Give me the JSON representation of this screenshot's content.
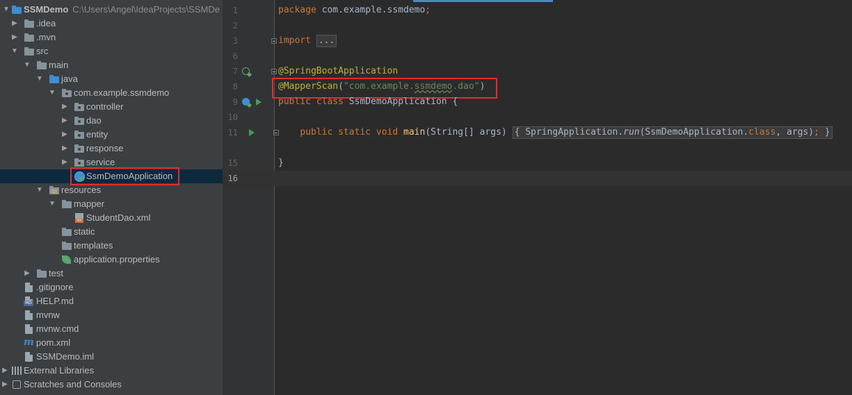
{
  "project": {
    "name": "SSMDemo",
    "path": "C:\\Users\\Angel\\IdeaProjects\\SSMDe",
    "items": [
      {
        "label": ".idea"
      },
      {
        "label": ".mvn"
      },
      {
        "label": "src"
      },
      {
        "label": "main"
      },
      {
        "label": "java"
      },
      {
        "label": "com.example.ssmdemo"
      },
      {
        "label": "controller"
      },
      {
        "label": "dao"
      },
      {
        "label": "entity"
      },
      {
        "label": "response"
      },
      {
        "label": "service"
      },
      {
        "label": "SsmDemoApplication"
      },
      {
        "label": "resources"
      },
      {
        "label": "mapper"
      },
      {
        "label": "StudentDao.xml"
      },
      {
        "label": "static"
      },
      {
        "label": "templates"
      },
      {
        "label": "application.properties"
      },
      {
        "label": "test"
      },
      {
        "label": ".gitignore"
      },
      {
        "label": "HELP.md"
      },
      {
        "label": "mvnw"
      },
      {
        "label": "mvnw.cmd"
      },
      {
        "label": "pom.xml"
      },
      {
        "label": "SSMDemo.iml"
      },
      {
        "label": "External Libraries"
      },
      {
        "label": "Scratches and Consoles"
      }
    ]
  },
  "editor": {
    "line_numbers": [
      "1",
      "2",
      "3",
      "6",
      "7",
      "8",
      "9",
      "10",
      "11",
      "15",
      "16"
    ],
    "line1": {
      "kw": "package",
      "pkg": " com.example.ssmdemo",
      "semi": ";"
    },
    "line3": {
      "kw": "import",
      "fold": "..."
    },
    "line7": {
      "ann": "@SpringBootApplication"
    },
    "line8": {
      "ann": "@MapperScan",
      "open": "(",
      "str_a": "\"com.example.",
      "str_b": "ssmdemo",
      "str_c": ".dao\"",
      "close": ")"
    },
    "line9": {
      "kw": "public class",
      "rest": " SsmDemoApplication {"
    },
    "line11": {
      "indent": "    ",
      "kw": "public static void",
      "sp": " ",
      "fn": "main",
      "params": "(String[] args) ",
      "brace_open": "{",
      "call_a": " SpringApplication.",
      "call_fn": "run",
      "call_b": "(SsmDemoApplication.",
      "call_kw": "class",
      "call_c": ", args)",
      "semi": ";",
      "brace_close": " }"
    },
    "line15": {
      "text": "}"
    }
  },
  "colors": {
    "keyword": "#cc7832",
    "annotation": "#bbb529",
    "string": "#6a8759",
    "method": "#ffc66d",
    "highlight": "#e62b2b"
  }
}
